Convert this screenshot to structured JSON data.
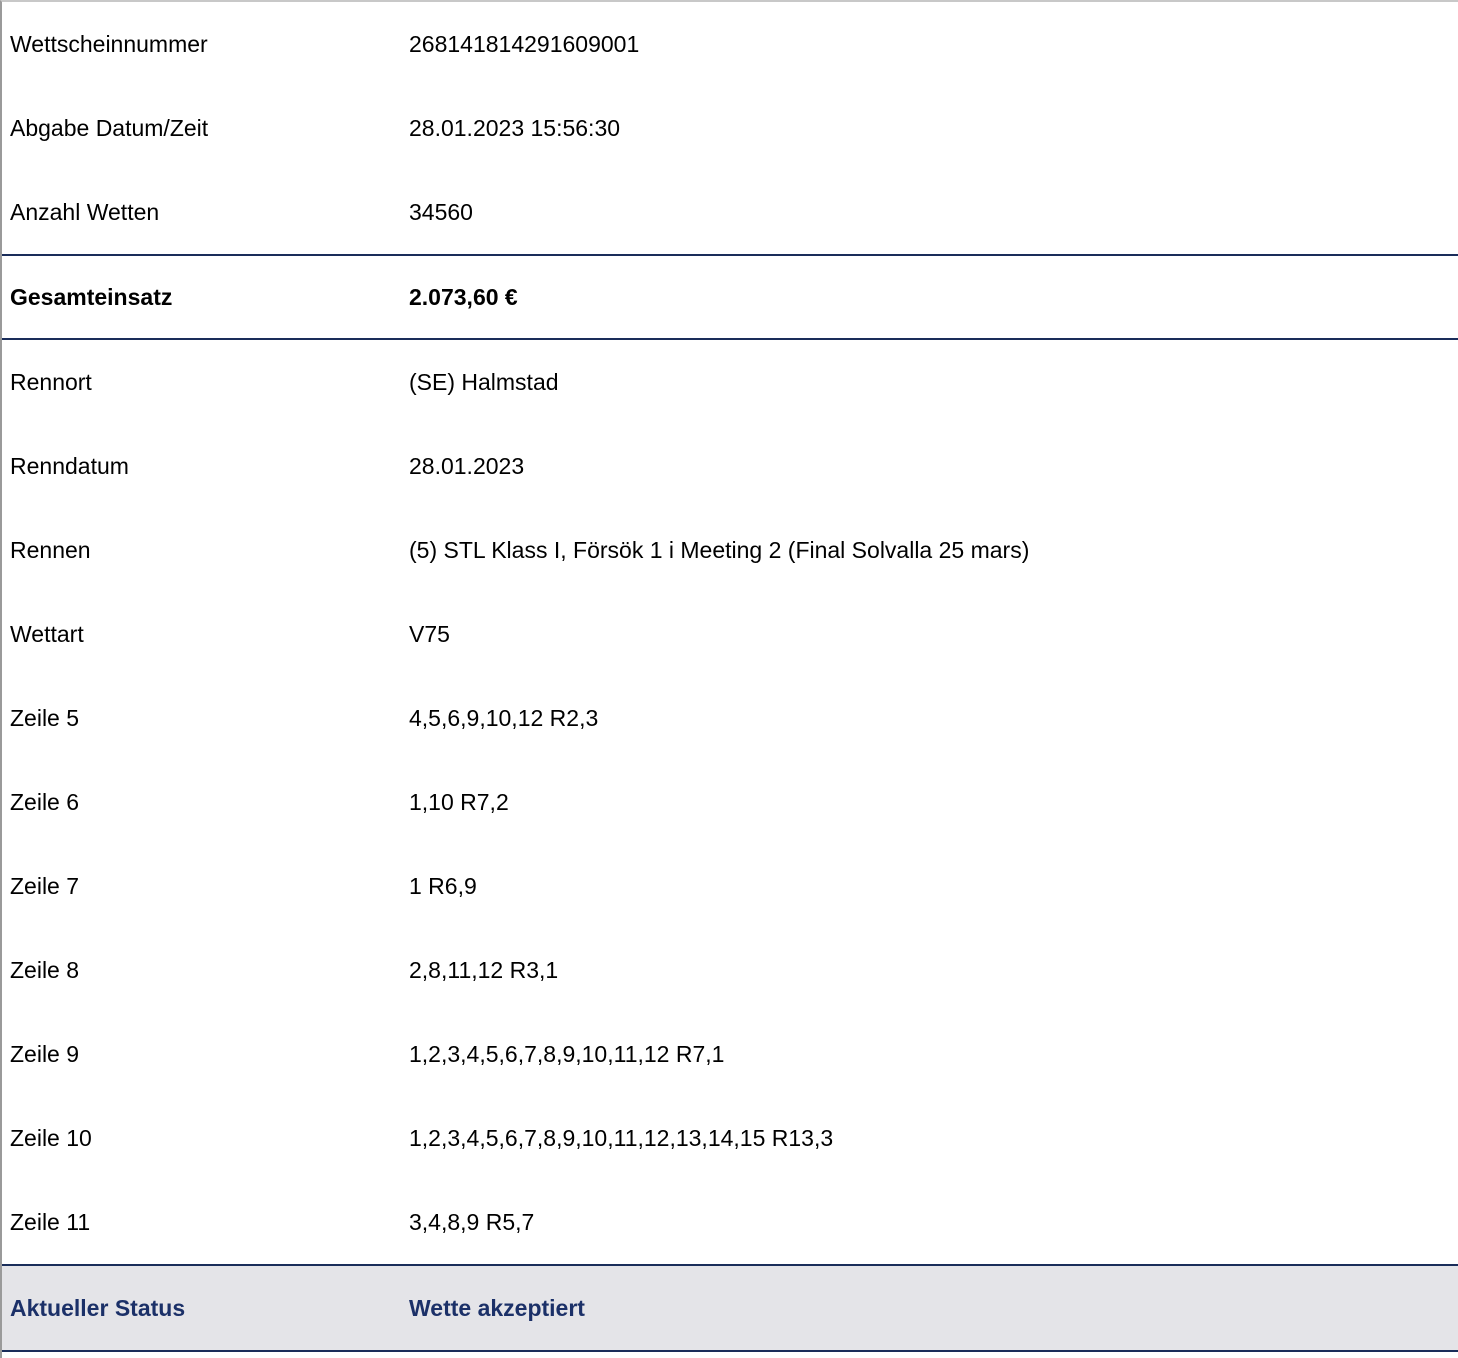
{
  "colors": {
    "accent_border": "#1a2d5a",
    "status_text": "#1b3068",
    "status_background": "#e4e4e8"
  },
  "ticket": {
    "ticket_number": {
      "label": "Wettscheinnummer",
      "value": "268141814291609001"
    },
    "submitted_at": {
      "label": "Abgabe Datum/Zeit",
      "value": "28.01.2023 15:56:30"
    },
    "bet_count": {
      "label": "Anzahl Wetten",
      "value": "34560"
    }
  },
  "total": {
    "label": "Gesamteinsatz",
    "value": "2.073,60 €"
  },
  "race": {
    "venue": {
      "label": "Rennort",
      "value": "(SE) Halmstad"
    },
    "race_date": {
      "label": "Renndatum",
      "value": "28.01.2023"
    },
    "race_name": {
      "label": "Rennen",
      "value": "(5) STL Klass I, Försök 1 i Meeting 2 (Final Solvalla 25 mars)"
    },
    "bet_type": {
      "label": "Wettart",
      "value": "V75"
    }
  },
  "lines": [
    {
      "label": "Zeile 5",
      "value": "4,5,6,9,10,12 R2,3"
    },
    {
      "label": "Zeile 6",
      "value": "1,10 R7,2"
    },
    {
      "label": "Zeile 7",
      "value": "1 R6,9"
    },
    {
      "label": "Zeile 8",
      "value": "2,8,11,12 R3,1"
    },
    {
      "label": "Zeile 9",
      "value": "1,2,3,4,5,6,7,8,9,10,11,12 R7,1"
    },
    {
      "label": "Zeile 10",
      "value": "1,2,3,4,5,6,7,8,9,10,11,12,13,14,15 R13,3"
    },
    {
      "label": "Zeile 11",
      "value": "3,4,8,9 R5,7"
    }
  ],
  "status": {
    "label": "Aktueller Status",
    "value": "Wette akzeptiert"
  }
}
